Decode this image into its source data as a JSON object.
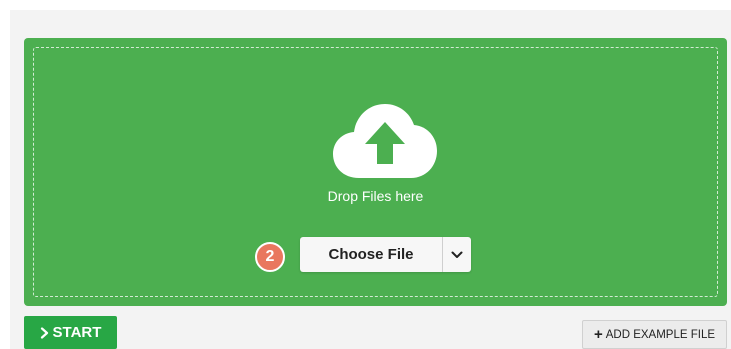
{
  "dropzone": {
    "drop_text": "Drop Files here",
    "choose_file_label": "Choose File",
    "step_badge": "2"
  },
  "actions": {
    "start_label": "START",
    "add_example_label": "ADD EXAMPLE FILE"
  },
  "icons": {
    "cloud": "cloud-upload-icon",
    "dropdown": "chevron-down-icon",
    "start": "chevron-right-icon",
    "add": "plus-icon"
  },
  "colors": {
    "dropzone_bg": "#4caf50",
    "start_bg": "#28a745",
    "badge_bg": "#e9775f",
    "panel_bg": "#f3f3f3"
  }
}
